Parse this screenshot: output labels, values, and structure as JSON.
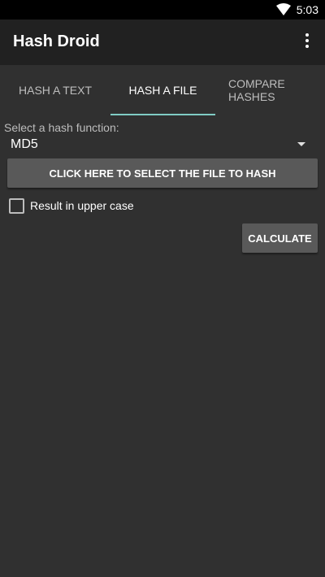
{
  "status_bar": {
    "time": "5:03"
  },
  "app_bar": {
    "title": "Hash Droid"
  },
  "tabs": [
    {
      "label": "HASH A TEXT"
    },
    {
      "label": "HASH A FILE"
    },
    {
      "label": "COMPARE HASHES"
    }
  ],
  "form": {
    "hash_function_label": "Select a hash function:",
    "hash_function_value": "MD5",
    "select_file_button": "CLICK HERE TO SELECT THE FILE TO HASH",
    "uppercase_label": "Result in upper case",
    "uppercase_checked": false,
    "calculate_button": "CALCULATE"
  },
  "colors": {
    "background": "#303030",
    "app_bar": "#212121",
    "tab_indicator": "#80cbc4",
    "button": "#595959"
  }
}
